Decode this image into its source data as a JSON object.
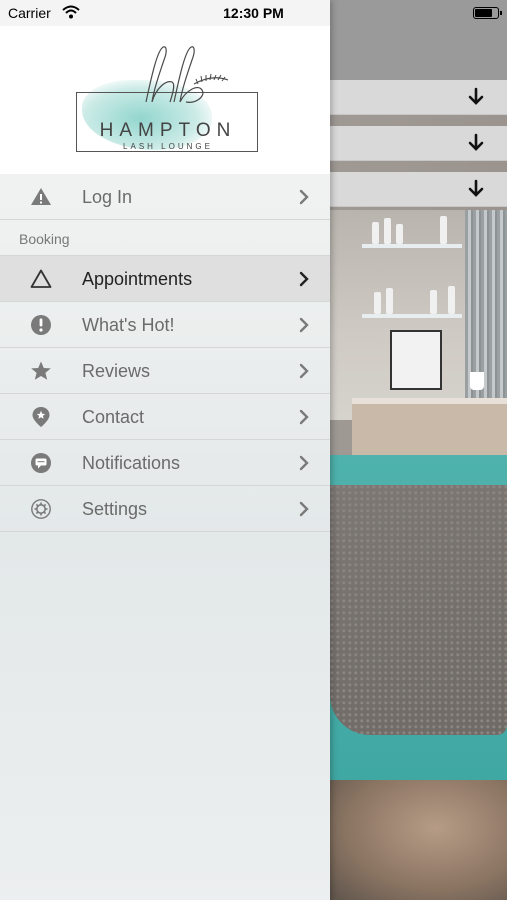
{
  "status_bar": {
    "carrier": "Carrier",
    "time": "12:30 PM",
    "battery_level": 0.8
  },
  "logo": {
    "monogram": "hb",
    "title": "HAMPTON",
    "subtitle": "LASH LOUNGE"
  },
  "menu": {
    "login": {
      "label": "Log In",
      "icon": "warning-icon"
    },
    "section_booking": "Booking",
    "items": [
      {
        "label": "Appointments",
        "icon": "triangle-icon",
        "active": true
      },
      {
        "label": "What's Hot!",
        "icon": "exclamation-icon",
        "active": false
      },
      {
        "label": "Reviews",
        "icon": "star-icon",
        "active": false
      },
      {
        "label": "Contact",
        "icon": "location-pin-icon",
        "active": false
      },
      {
        "label": "Notifications",
        "icon": "chat-bubble-icon",
        "active": false
      },
      {
        "label": "Settings",
        "icon": "gear-icon",
        "active": false
      }
    ]
  },
  "colors": {
    "icon_gray": "#7a7a7a",
    "active_text": "#222222",
    "inactive_text": "#6b6b6b",
    "teal_wash": "#6ec8be"
  }
}
